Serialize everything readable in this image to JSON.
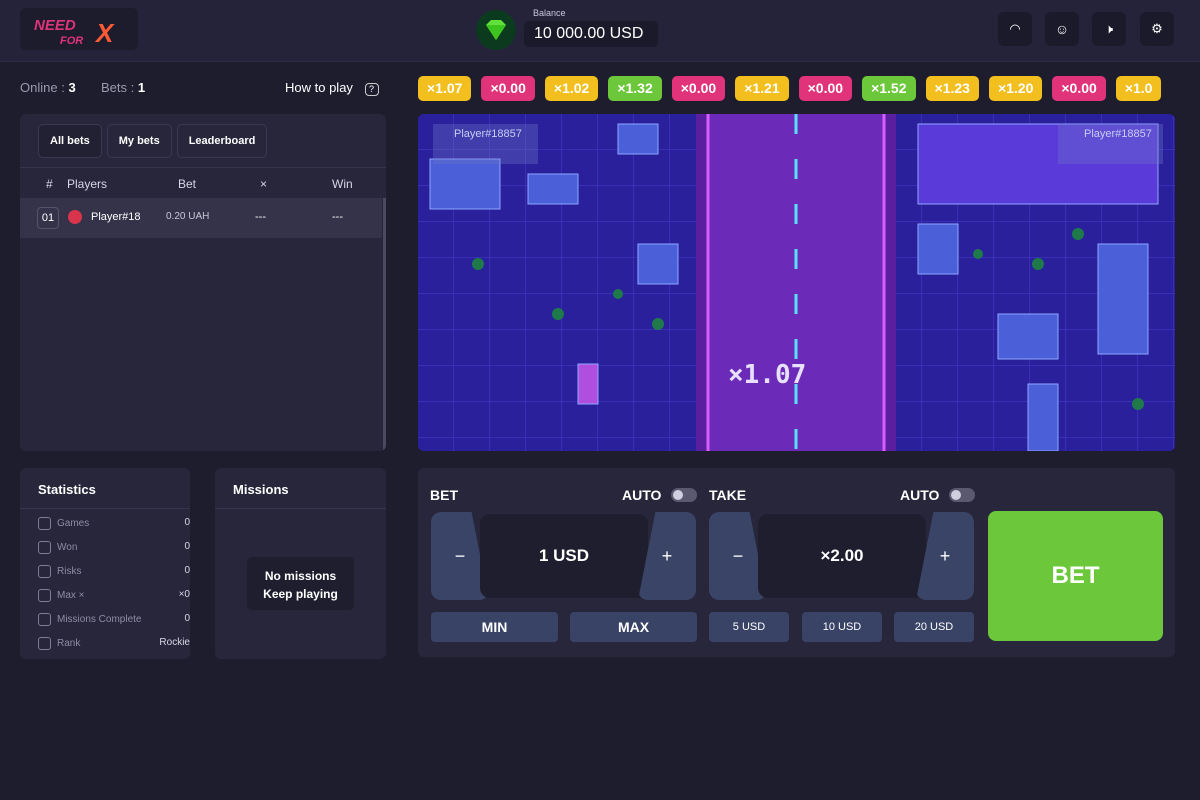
{
  "header": {
    "logo_text": "NEED FOR X",
    "balance_label": "Balance",
    "balance": "10 000.00 USD",
    "icons": [
      "wifi-icon",
      "user-icon",
      "sound-icon",
      "settings-icon"
    ]
  },
  "info": {
    "online_label": "Online :",
    "online": "3",
    "bets_label": "Bets :",
    "bets": "1",
    "how_to_play": "How to play"
  },
  "history": [
    {
      "v": "×1.07",
      "c": "#f2bf1e"
    },
    {
      "v": "×0.00",
      "c": "#e0337a"
    },
    {
      "v": "×1.02",
      "c": "#f2bf1e"
    },
    {
      "v": "×1.32",
      "c": "#6cc83a"
    },
    {
      "v": "×0.00",
      "c": "#e0337a"
    },
    {
      "v": "×1.21",
      "c": "#f2bf1e"
    },
    {
      "v": "×0.00",
      "c": "#e0337a"
    },
    {
      "v": "×1.52",
      "c": "#6cc83a"
    },
    {
      "v": "×1.23",
      "c": "#f2bf1e"
    },
    {
      "v": "×1.20",
      "c": "#f2bf1e"
    },
    {
      "v": "×0.00",
      "c": "#e0337a"
    },
    {
      "v": "×1.0",
      "c": "#f2bf1e"
    }
  ],
  "bets_panel": {
    "tabs": [
      "All bets",
      "My bets",
      "Leaderboard"
    ],
    "columns": [
      "#",
      "Players",
      "Bet",
      "×",
      "Win"
    ],
    "rows": [
      {
        "num": "01",
        "player": "Player#18",
        "bet": "0.20 UAH",
        "mult": "---",
        "win": "---"
      }
    ]
  },
  "statistics": {
    "title": "Statistics",
    "items": [
      {
        "label": "Games",
        "value": "0"
      },
      {
        "label": "Won",
        "value": "0"
      },
      {
        "label": "Risks",
        "value": "0"
      },
      {
        "label": "Max ×",
        "value": "×0"
      },
      {
        "label": "Missions Complete",
        "value": "0"
      },
      {
        "label": "Rank",
        "value": "Rockie"
      }
    ]
  },
  "missions": {
    "title": "Missions",
    "line1": "No missions",
    "line2": "Keep playing"
  },
  "game": {
    "multiplier": "×1.07",
    "player_tag_left": "Player#18857",
    "player_tag_right": "Player#18857"
  },
  "controls": {
    "bet_label": "BET",
    "auto_label": "AUTO",
    "bet_value": "1 USD",
    "min": "MIN",
    "max": "MAX",
    "minus": "−",
    "plus": "+",
    "take_label": "TAKE",
    "take_value": "×2.00",
    "quick": [
      "5 USD",
      "10 USD",
      "20 USD"
    ],
    "bet_button": "BET",
    "auto_bet": false,
    "auto_take": false
  }
}
